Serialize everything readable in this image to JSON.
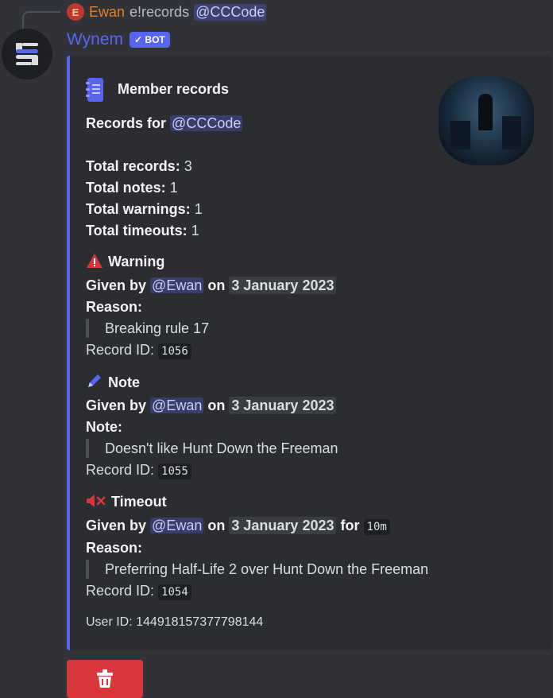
{
  "reply": {
    "author": "Ewan",
    "command": "e!records",
    "mention": "@CCCode"
  },
  "bot": {
    "name": "Wynem",
    "tag": "BOT",
    "tag_check": "✓"
  },
  "embed": {
    "title": "Member records",
    "records_for_label": "Records for",
    "records_for_mention": "@CCCode",
    "totals": [
      {
        "label": "Total records:",
        "value": "3"
      },
      {
        "label": "Total notes:",
        "value": "1"
      },
      {
        "label": "Total warnings:",
        "value": "1"
      },
      {
        "label": "Total timeouts:",
        "value": "1"
      }
    ],
    "records": [
      {
        "type": "Warning",
        "given_by": "Given by",
        "user": "@Ewan",
        "on": "on",
        "date": "3 January 2023",
        "reason_label": "Reason:",
        "text": "Breaking rule 17",
        "id_label": "Record ID:",
        "id": "1056"
      },
      {
        "type": "Note",
        "given_by": "Given by",
        "user": "@Ewan",
        "on": "on",
        "date": "3 January 2023",
        "reason_label": "Note:",
        "text": "Doesn't like Hunt Down the Freeman",
        "id_label": "Record ID:",
        "id": "1055"
      },
      {
        "type": "Timeout",
        "given_by": "Given by",
        "user": "@Ewan",
        "on": "on",
        "date": "3 January 2023",
        "for": "for",
        "duration": "10m",
        "reason_label": "Reason:",
        "text": "Preferring Half-Life 2 over Hunt Down the Freeman",
        "id_label": "Record ID:",
        "id": "1054"
      }
    ],
    "footer": "User ID: 144918157377798144"
  },
  "colors": {
    "background": "#313338",
    "embed_bg": "#2b2d31",
    "accent": "#5865f2",
    "delete": "#da373c",
    "reply_author": "#e67e22"
  },
  "icons": [
    "notebook-icon",
    "warning-icon",
    "pencil-icon",
    "mute-icon",
    "trash-icon"
  ]
}
